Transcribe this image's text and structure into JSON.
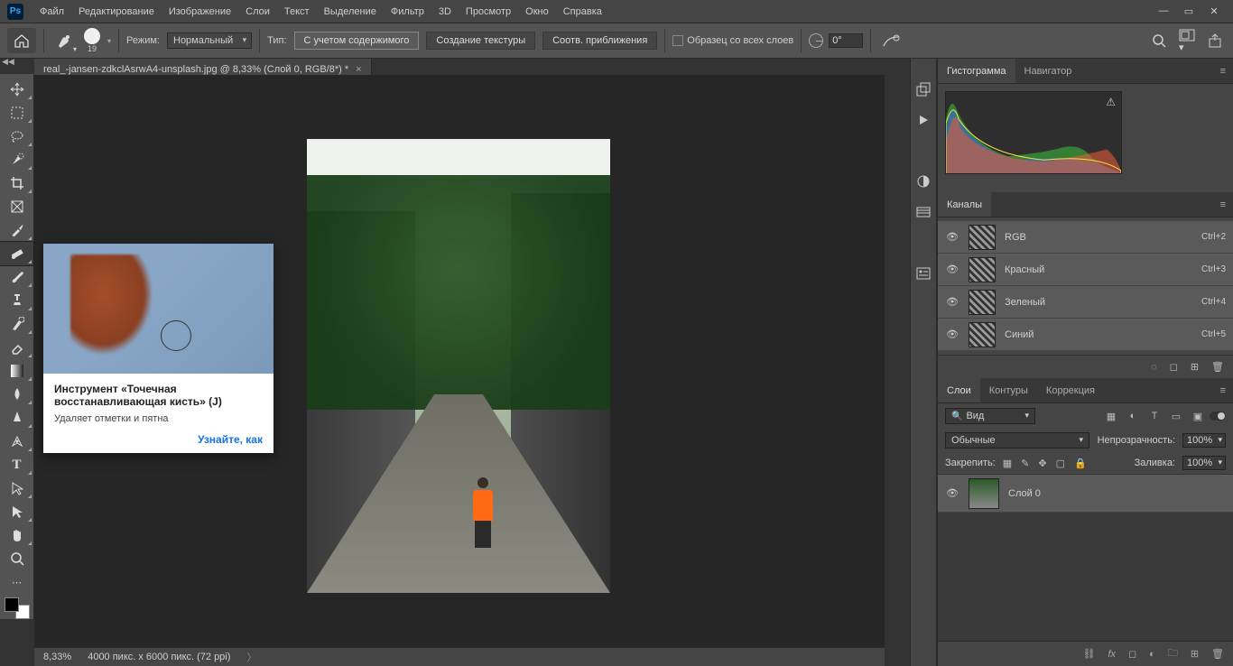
{
  "menu": {
    "items": [
      "Файл",
      "Редактирование",
      "Изображение",
      "Слои",
      "Текст",
      "Выделение",
      "Фильтр",
      "3D",
      "Просмотр",
      "Окно",
      "Справка"
    ]
  },
  "options": {
    "brush_size": "19",
    "mode_label": "Режим:",
    "mode_value": "Нормальный",
    "type_label": "Тип:",
    "btn_content_aware": "С учетом содержимого",
    "btn_create_texture": "Создание текстуры",
    "btn_proximity": "Соотв. приближения",
    "sample_all": "Образец со всех слоев",
    "angle_value": "0°"
  },
  "tab": {
    "title": "real_-jansen-zdkclAsrwA4-unsplash.jpg @ 8,33% (Слой 0, RGB/8*) *"
  },
  "tooltip": {
    "title": "Инструмент «Точечная восстанавливающая кисть» (J)",
    "desc": "Удаляет отметки и пятна",
    "link": "Узнайте, как"
  },
  "status": {
    "zoom": "8,33%",
    "docinfo": "4000 пикс. x 6000 пикс. (72 ppi)"
  },
  "panels": {
    "histogram_tab": "Гистограмма",
    "navigator_tab": "Навигатор",
    "channels_tab": "Каналы",
    "channels": [
      {
        "name": "RGB",
        "shortcut": "Ctrl+2"
      },
      {
        "name": "Красный",
        "shortcut": "Ctrl+3"
      },
      {
        "name": "Зеленый",
        "shortcut": "Ctrl+4"
      },
      {
        "name": "Синий",
        "shortcut": "Ctrl+5"
      }
    ],
    "layers_tab": "Слои",
    "paths_tab": "Контуры",
    "adjustments_tab": "Коррекция",
    "kind_filter": "Вид",
    "blend_mode": "Обычные",
    "opacity_label": "Непрозрачность:",
    "opacity_value": "100%",
    "lock_label": "Закрепить:",
    "fill_label": "Заливка:",
    "fill_value": "100%",
    "layer0": "Слой 0"
  }
}
